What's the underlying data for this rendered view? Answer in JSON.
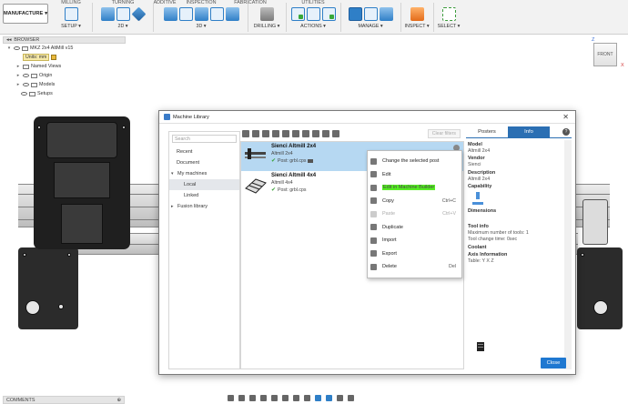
{
  "toolbar": {
    "workspace": "MANUFACTURE",
    "tab_milling": "MILLING",
    "tab_turning": "TURNING",
    "tab_additive": "ADDITIVE",
    "tab_inspection": "INSPECTION",
    "tab_fabrication": "FABRICATION",
    "tab_utilities": "UTILITIES",
    "setup": "SETUP ▾",
    "g2d": "2D ▾",
    "g3d": "3D ▾",
    "drilling": "DRILLING ▾",
    "actions": "ACTIONS ▾",
    "manage": "MANAGE ▾",
    "inspect": "INSPECT ▾",
    "select": "SELECT ▾"
  },
  "browser": {
    "title": "BROWSER",
    "root": "MKZ 2x4 AltMill v15",
    "units": "Units: mm",
    "named_views": "Named Views",
    "origin": "Origin",
    "models": "Models",
    "setups": "Setups"
  },
  "viewcube": {
    "face": "FRONT",
    "z": "Z",
    "x": "X"
  },
  "comments": {
    "label": "COMMENTS"
  },
  "dialog": {
    "title": "Machine Library",
    "search_placeholder": "Search",
    "nav": {
      "recent": "Recent",
      "document": "Document",
      "my_machines": "My machines",
      "local": "Local",
      "linked": "Linked",
      "fusion_library": "Fusion library"
    },
    "clear_filters": "Clear filters",
    "machines": [
      {
        "name": "Sienci Altmill 2x4",
        "model": "Altmill 2x4",
        "post": "Post: grbl.cps"
      },
      {
        "name": "Sienci Altmill 4x4",
        "model": "Altmill 4x4",
        "post": "Post: grbl.cps"
      }
    ],
    "context_menu": {
      "change_post": "Change the selected post",
      "edit": "Edit",
      "edit_builder": "Edit in Machine Builder",
      "copy": "Copy",
      "copy_short": "Ctrl+C",
      "paste": "Paste",
      "paste_short": "Ctrl+V",
      "duplicate": "Duplicate",
      "import": "Import",
      "export": "Export",
      "delete": "Delete",
      "delete_short": "Del"
    },
    "tabs": {
      "posters": "Posters",
      "info": "Info"
    },
    "info": {
      "model_h": "Model",
      "model_v": "Altmill 2x4",
      "vendor_h": "Vendor",
      "vendor_v": "Sienci",
      "desc_h": "Description",
      "desc_v": "Altmill 2x4",
      "cap_h": "Capability",
      "dim_h": "Dimensions",
      "tool_h": "Tool info",
      "tool_max": "Maximum number of tools: 1",
      "tool_change": "Tool change time: 0sec",
      "coolant_h": "Coolant",
      "axis_h": "Axis Information",
      "axis_v": "Table: Y X Z"
    },
    "close": "Close"
  },
  "colors": {
    "accent": "#1f78d1",
    "selection": "#b6d8f2",
    "highlight": "#55ee22"
  }
}
